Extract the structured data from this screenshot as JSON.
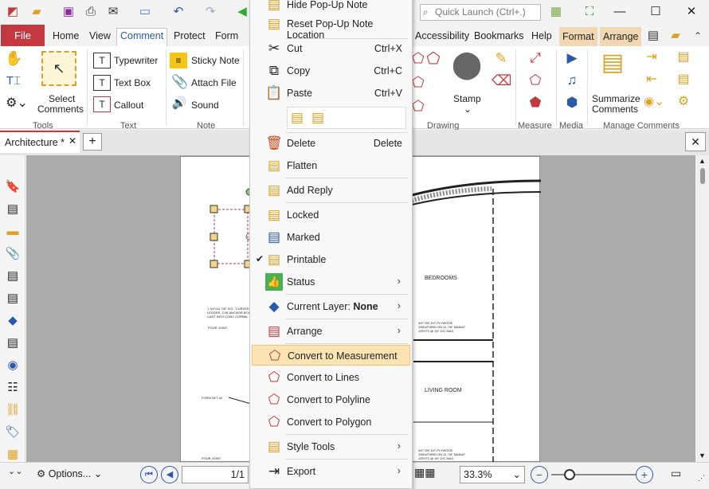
{
  "title_bar": {
    "search_placeholder": "Quick Launch (Ctrl+.)"
  },
  "ribbon_tabs": {
    "file": "File",
    "home": "Home",
    "view": "View",
    "comment": "Comment",
    "protect": "Protect",
    "form": "Form",
    "accessibility": "Accessibility",
    "bookmarks": "Bookmarks",
    "help": "Help",
    "format": "Format",
    "arrange": "Arrange"
  },
  "ribbon": {
    "select_comments": "Select\nComments",
    "select_line1": "Select",
    "select_line2": "Comments",
    "typewriter": "Typewriter",
    "textbox": "Text Box",
    "callout": "Callout",
    "sticky_note": "Sticky Note",
    "attach_file": "Attach File",
    "sound": "Sound",
    "stamp": "Stamp",
    "summarize_line1": "Summarize",
    "summarize_line2": "Comments",
    "groups": {
      "tools": "Tools",
      "text": "Text",
      "note": "Note",
      "drawing": "Drawing",
      "measure": "Measure",
      "media": "Media",
      "manage": "Manage Comments"
    }
  },
  "doc_tab": {
    "name": "Architecture *"
  },
  "document_text": {
    "bedrooms": "BEDROOMS",
    "living_room": "LIVING ROOM",
    "note1": "1 3/4\"x11 7/8\" SCL \"CURVED LEDGER, C/W ANCHOR BOLTS CAST INTO CONC CORBEL",
    "note2": "3/4\" OR 3/4\" PLYWOOD SHEATHING ON 11 7/8\" MANUF JOISTS @ 16\" O/C MAX",
    "note3": "3/4\" OR 3/4\" PLYWOOD SHEATHING ON 11 7/8\" MANUF JOISTS @ 16\" O/C MAX",
    "pour_joint": "POUR JOINT",
    "form_set": "FORM SET #2",
    "pour_joint2": "POUR JOINT"
  },
  "status_bar": {
    "options": "Options...",
    "page": "1/1",
    "zoom": "33.3%"
  },
  "context_menu": {
    "items": [
      {
        "label": "Hide Pop-Up Note",
        "shortcut": ""
      },
      {
        "label": "Reset Pop-Up Note Location",
        "shortcut": ""
      },
      {
        "label": "Cut",
        "shortcut": "Ctrl+X"
      },
      {
        "label": "Copy",
        "shortcut": "Ctrl+C"
      },
      {
        "label": "Paste",
        "shortcut": "Ctrl+V"
      },
      {
        "label": "Delete",
        "shortcut": "Delete"
      },
      {
        "label": "Flatten",
        "shortcut": ""
      },
      {
        "label": "Add Reply",
        "shortcut": ""
      },
      {
        "label": "Locked",
        "shortcut": ""
      },
      {
        "label": "Marked",
        "shortcut": ""
      },
      {
        "label": "Printable",
        "shortcut": ""
      },
      {
        "label": "Status",
        "shortcut": ""
      },
      {
        "label": "Current Layer: ",
        "bold": "None"
      },
      {
        "label": "Arrange",
        "shortcut": ""
      },
      {
        "label": "Convert to Measurement",
        "shortcut": ""
      },
      {
        "label": "Convert to Lines",
        "shortcut": ""
      },
      {
        "label": "Convert to Polyline",
        "shortcut": ""
      },
      {
        "label": "Convert to Polygon",
        "shortcut": ""
      },
      {
        "label": "Style Tools",
        "shortcut": ""
      },
      {
        "label": "Export",
        "shortcut": ""
      }
    ],
    "printable_checked": "✔"
  },
  "colors": {
    "file_tab": "#c3393f",
    "highlight": "#fce4b3",
    "active_tab_text": "#2a5aa8",
    "context_tab": "#f2d8b2"
  }
}
